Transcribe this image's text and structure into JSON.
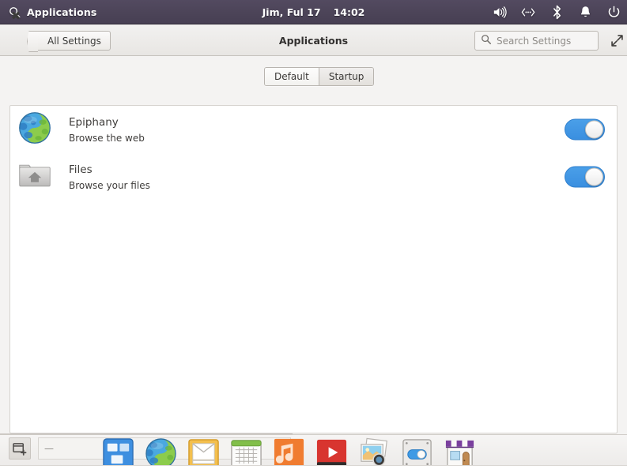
{
  "topbar": {
    "search_icon": "search-icon",
    "app_menu_label": "Applications",
    "clock_date": "Jim, Ful 17",
    "clock_time": "14:02",
    "indicators": [
      {
        "name": "volume-icon",
        "label": "Volume"
      },
      {
        "name": "network-icon",
        "label": "Network"
      },
      {
        "name": "bluetooth-icon",
        "label": "Bluetooth"
      },
      {
        "name": "notification-bell-icon",
        "label": "Notifications"
      },
      {
        "name": "power-icon",
        "label": "Power"
      }
    ]
  },
  "headerbar": {
    "close_label": "✖",
    "back_label": "All Settings",
    "title": "Applications",
    "search_placeholder": "Search Settings",
    "search_value": "",
    "search_icon": "search-icon",
    "expand_icon": "expand-icon"
  },
  "tabs": [
    {
      "label": "Default",
      "active": true
    },
    {
      "label": "Startup",
      "active": false
    }
  ],
  "apps": [
    {
      "name": "Epiphany",
      "description": "Browse the web",
      "icon": "web-browser-globe-icon",
      "toggle_on": true
    },
    {
      "name": "Files",
      "description": "Browse your files",
      "icon": "file-manager-folder-icon",
      "toggle_on": true
    }
  ],
  "dock": {
    "new_workspace_icon": "add-window-icon",
    "window_list_label": "—",
    "items": [
      {
        "name": "workspace-switcher-icon",
        "label": "Workspace Switcher"
      },
      {
        "name": "web-browser-icon",
        "label": "Web Browser"
      },
      {
        "name": "mail-icon",
        "label": "Mail"
      },
      {
        "name": "calendar-icon",
        "label": "Calendar"
      },
      {
        "name": "music-icon",
        "label": "Music"
      },
      {
        "name": "video-icon",
        "label": "Videos"
      },
      {
        "name": "photos-icon",
        "label": "Photos"
      },
      {
        "name": "settings-icon",
        "label": "Settings"
      },
      {
        "name": "software-store-icon",
        "label": "Software"
      }
    ]
  },
  "colors": {
    "panel_bg": "#4c4458",
    "accent_blue": "#3a8fe0",
    "content_bg": "#f4f3f2",
    "card_bg": "#ffffff"
  }
}
